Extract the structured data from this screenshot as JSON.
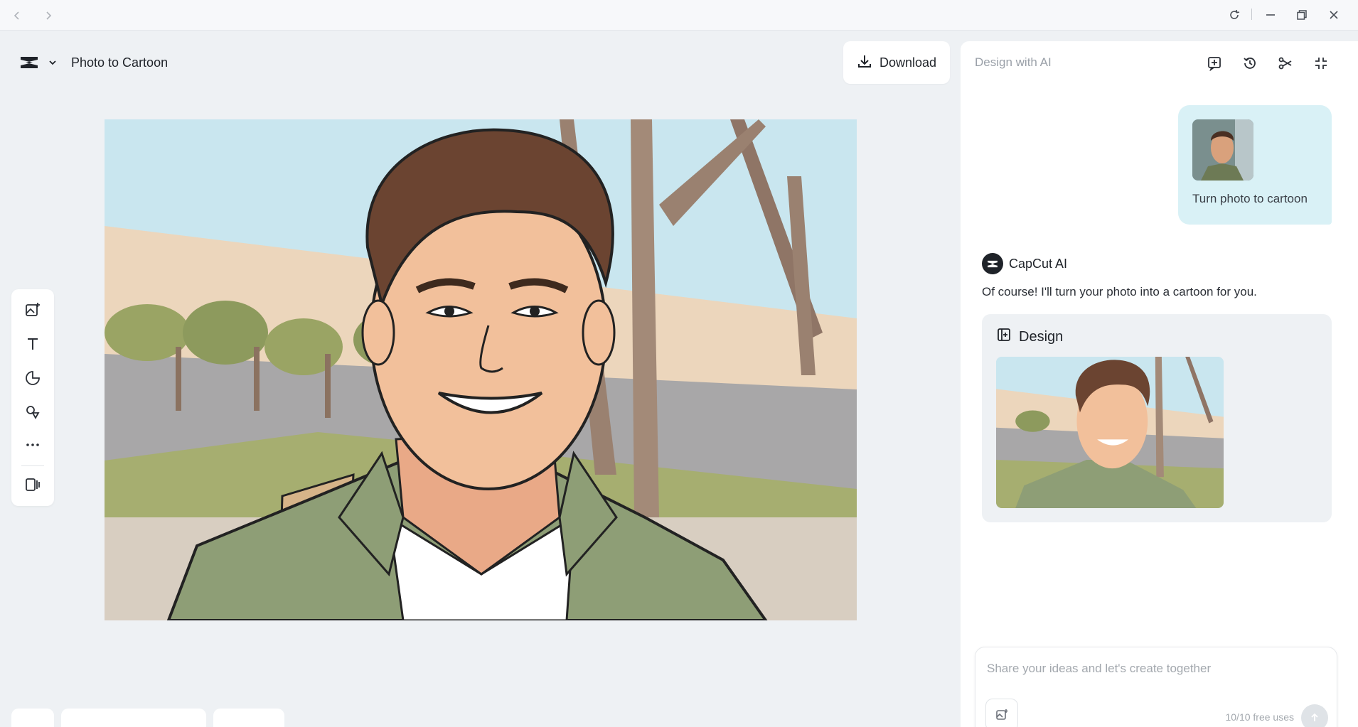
{
  "app": {
    "project_title": "Photo to Cartoon",
    "download_label": "Download"
  },
  "panel": {
    "title": "Design with AI",
    "user_message": "Turn photo to cartoon",
    "ai_name": "CapCut AI",
    "ai_message": "Of course! I'll turn your photo into a cartoon for you.",
    "design_label": "Design",
    "input_placeholder": "Share your ideas and let's create together",
    "free_uses": "10/10 free uses"
  },
  "colors": {
    "accent_bubble": "#d9f1f6",
    "panel_bg": "#ffffff",
    "app_bg": "#eef1f4"
  },
  "icons": {
    "back": "back-arrow-icon",
    "forward": "forward-arrow-icon",
    "reload": "reload-icon",
    "minimize": "minimize-icon",
    "restore": "restore-icon",
    "close": "close-icon",
    "logo": "capcut-logo-icon",
    "download": "download-icon",
    "left_tools": [
      "add-image-icon",
      "text-icon",
      "sticker-icon",
      "shapes-icon",
      "more-icon",
      "layout-icon"
    ],
    "panel_tools": [
      "new-chat-icon",
      "history-icon",
      "share-icon",
      "collapse-icon"
    ]
  }
}
